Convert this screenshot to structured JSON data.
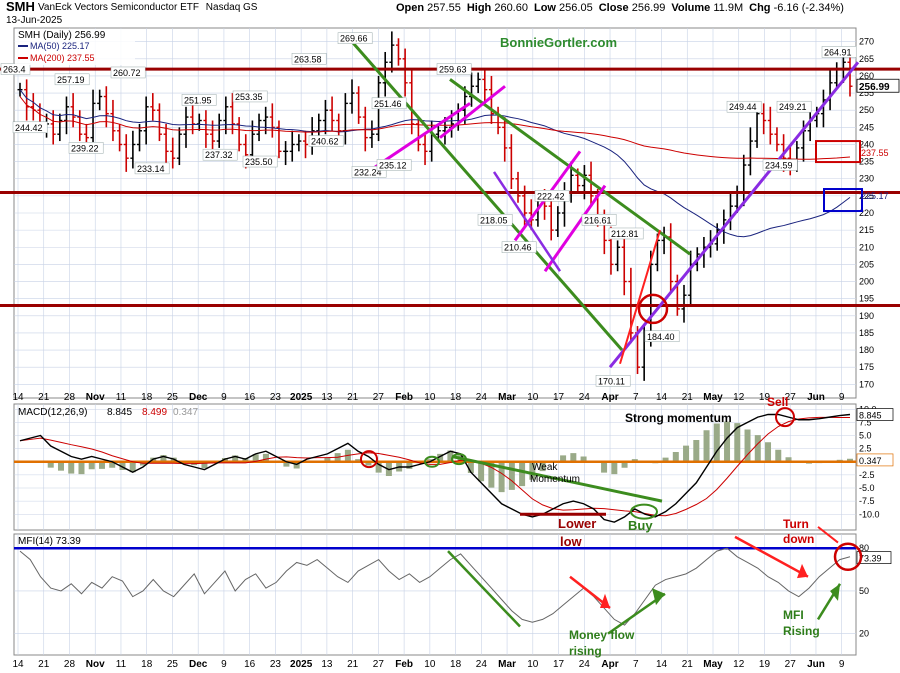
{
  "header": {
    "ticker": "SMH",
    "description": "VanEck Vectors Semiconductor ETF",
    "exchange": "Nasdaq GS",
    "date": "13-Jun-2025",
    "ohlc": [
      {
        "label": "Open",
        "value": "257.55"
      },
      {
        "label": "High",
        "value": "260.60"
      },
      {
        "label": "Low",
        "value": "256.05"
      },
      {
        "label": "Close",
        "value": "256.99"
      },
      {
        "label": "Volume",
        "value": "11.9M"
      },
      {
        "label": "Chg",
        "value": "-6.16 (-2.34%)"
      }
    ],
    "watermark": "BonnieGortler.com"
  },
  "legend": {
    "price": "SMH (Daily) 256.99",
    "ma50": "MA(50) 225.17",
    "ma200": "MA(200) 237.55",
    "macd_name": "MACD(12,26,9)",
    "macd_v1": "8.845",
    "macd_v2": "8.499",
    "macd_v3": "0.347",
    "mfi": "MFI(14) 73.39"
  },
  "colors": {
    "ma50": "#1a237e",
    "ma200": "#cc0000",
    "trend_green": "#3c8c1e",
    "trend_magenta": "#e000e0",
    "trend_purple": "#8a2be2",
    "support_red": "#990000",
    "annot_red": "#cc0000",
    "signal_orange": "#e07000",
    "mfi_blue": "#0000cc",
    "grid": "#c8d2e6"
  },
  "chart_data": [
    {
      "type": "candlestick",
      "title": "SMH (Daily)",
      "y_ticks": [
        170,
        175,
        180,
        185,
        190,
        195,
        200,
        205,
        210,
        215,
        220,
        225,
        230,
        235,
        240,
        245,
        250,
        255,
        260,
        265,
        270
      ],
      "ylim": [
        166,
        274
      ],
      "x_tick_labels": [
        "14",
        "21",
        "28",
        "Nov",
        "11",
        "18",
        "25",
        "Dec",
        "9",
        "16",
        "23",
        "2025",
        "13",
        "21",
        "27",
        "Feb",
        "10",
        "18",
        "24",
        "Mar",
        "10",
        "17",
        "24",
        "Apr",
        "7",
        "14",
        "21",
        "May",
        "12",
        "19",
        "27",
        "Jun",
        "9"
      ],
      "close_path": [
        256,
        251,
        250,
        246,
        246,
        243,
        247,
        251,
        248,
        243,
        242,
        252,
        254,
        249,
        244,
        240,
        236,
        240,
        244,
        251,
        250,
        243,
        238,
        236,
        243,
        248,
        246,
        247,
        243,
        241,
        247,
        251,
        246,
        240,
        237,
        243,
        247,
        248,
        245,
        238,
        238,
        240,
        241,
        240,
        244,
        247,
        250,
        247,
        244,
        252,
        255,
        248,
        242,
        243,
        258,
        264,
        269,
        265,
        258,
        246,
        240,
        238,
        243,
        244,
        245,
        246,
        250,
        254,
        257,
        259,
        256,
        249,
        245,
        239,
        230,
        225,
        220,
        218,
        224,
        222,
        215,
        220,
        226,
        231,
        228,
        231,
        225,
        218,
        212,
        205,
        210,
        200,
        185,
        175,
        184,
        205,
        212,
        213,
        200,
        192,
        196,
        205,
        208,
        210,
        211,
        215,
        218,
        222,
        226,
        234,
        241,
        249,
        247,
        243,
        240,
        236,
        234,
        239,
        244,
        247,
        249,
        253,
        258,
        262,
        264,
        257
      ],
      "price_labels": [
        {
          "text": "263.4",
          "x": "Oct 14"
        },
        {
          "text": "244.42",
          "x": "Oct 16"
        },
        {
          "text": "257.19",
          "x": "Oct 28"
        },
        {
          "text": "239.22",
          "x": "Nov 1"
        },
        {
          "text": "260.72",
          "x": "Nov 7"
        },
        {
          "text": "233.14",
          "x": "Nov 21"
        },
        {
          "text": "251.95",
          "x": "Dec 2"
        },
        {
          "text": "237.32",
          "x": "Dec 5"
        },
        {
          "text": "253.35",
          "x": "Dec 16"
        },
        {
          "text": "235.50",
          "x": "Dec 20"
        },
        {
          "text": "263.58",
          "x": "Dec 31"
        },
        {
          "text": "240.62",
          "x": "Jan 13"
        },
        {
          "text": "269.66",
          "x": "Jan 22"
        },
        {
          "text": "232.24",
          "x": "Jan 27"
        },
        {
          "text": "251.46",
          "x": "Jan 30"
        },
        {
          "text": "235.12",
          "x": "Feb 3"
        },
        {
          "text": "259.63",
          "x": "Feb 19"
        },
        {
          "text": "218.05",
          "x": "Mar 10"
        },
        {
          "text": "210.46",
          "x": "Mar 13"
        },
        {
          "text": "222.42",
          "x": "Mar 25"
        },
        {
          "text": "216.61",
          "x": "Apr 2"
        },
        {
          "text": "212.81",
          "x": "Apr 9"
        },
        {
          "text": "170.11",
          "x": "Apr 7"
        },
        {
          "text": "184.40",
          "x": "Apr 21"
        },
        {
          "text": "249.44",
          "x": "May 13"
        },
        {
          "text": "249.21",
          "x": "May 28"
        },
        {
          "text": "234.59",
          "x": "May 23"
        },
        {
          "text": "264.91",
          "x": "Jun 11"
        }
      ],
      "right_labels": {
        "close": "256.99",
        "ma200": "237.55",
        "ma50": "225.17"
      },
      "horizontal_lines": [
        {
          "name": "resistance",
          "value": 262
        },
        {
          "name": "support-mid",
          "value": 226
        },
        {
          "name": "support-low",
          "value": 193
        }
      ]
    },
    {
      "type": "line",
      "title": "MACD(12,26,9)",
      "y_ticks": [
        "10.0",
        "7.5",
        "5.0",
        "2.5",
        "0.0",
        "-2.5",
        "-5.0",
        "-7.5",
        "-10.0"
      ],
      "ylim": [
        -13,
        11
      ],
      "value_labels": [
        "8.845",
        "0.347"
      ],
      "macd": [
        4,
        4.5,
        5,
        3,
        2,
        1,
        0.5,
        1,
        0.5,
        0,
        -1,
        -2,
        -1,
        0.5,
        1,
        0.5,
        -0.5,
        -1,
        -1.5,
        -0.5,
        0.5,
        1,
        0.5,
        1.5,
        2,
        1,
        0,
        -0.5,
        0.5,
        1,
        1.5,
        2.5,
        3.5,
        2,
        1,
        -0.5,
        -1.5,
        -1,
        -1,
        -0.5,
        0,
        1,
        2,
        1.5,
        -2,
        -4,
        -6,
        -8,
        -9,
        -10,
        -10.5,
        -10,
        -9,
        -8,
        -7.5,
        -8,
        -9,
        -11,
        -11.5,
        -10.5,
        -9,
        -10,
        -10.5,
        -9.5,
        -8,
        -6,
        -4,
        -1,
        2,
        4.5,
        6.5,
        7.5,
        8.5,
        9,
        9,
        8.5,
        8,
        8,
        8.2,
        8.5,
        8.8,
        9
      ],
      "annotations": [
        "Strong momentum",
        "Weak Momentum",
        "Sell",
        "Lower low",
        "Buy"
      ]
    },
    {
      "type": "line",
      "title": "MFI(14)",
      "y_ticks": [
        "80",
        "50",
        "20"
      ],
      "ylim": [
        5,
        90
      ],
      "value_labels": [
        "73.39"
      ],
      "reference_line": 80,
      "mfi": [
        78,
        72,
        60,
        52,
        50,
        55,
        48,
        56,
        52,
        60,
        57,
        46,
        50,
        58,
        50,
        46,
        54,
        62,
        48,
        56,
        64,
        50,
        58,
        62,
        52,
        56,
        64,
        70,
        68,
        72,
        66,
        60,
        56,
        64,
        68,
        72,
        64,
        58,
        62,
        56,
        60,
        66,
        72,
        76,
        68,
        60,
        52,
        44,
        36,
        30,
        28,
        30,
        34,
        40,
        46,
        52,
        46,
        38,
        30,
        26,
        34,
        44,
        54,
        58,
        60,
        62,
        66,
        72,
        78,
        80,
        74,
        70,
        66,
        60,
        56,
        50,
        46,
        52,
        60,
        66,
        72,
        74
      ],
      "annotations": [
        "Money flow rising",
        "MFI Rising",
        "Turn down"
      ]
    }
  ]
}
